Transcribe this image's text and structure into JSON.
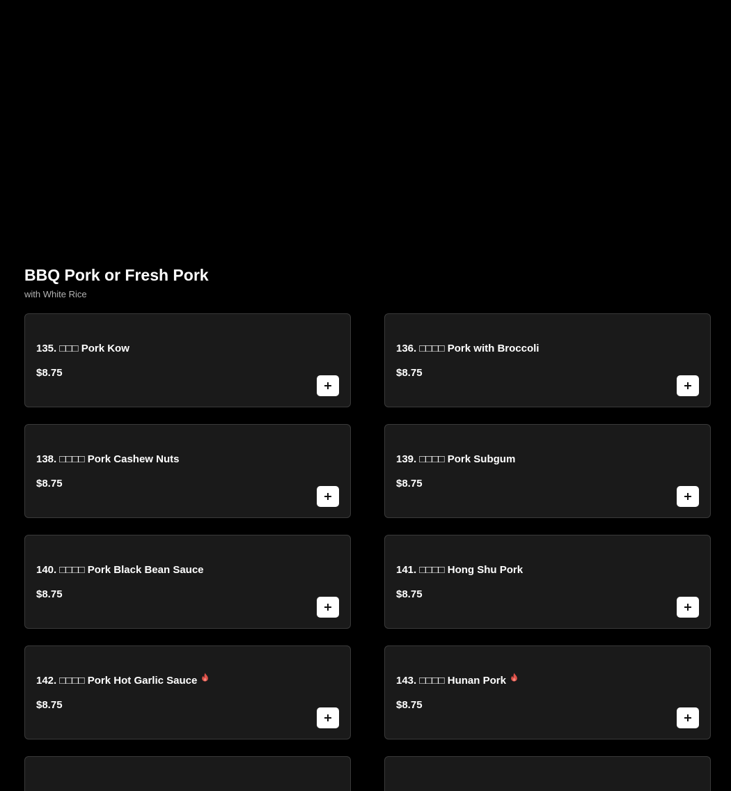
{
  "section": {
    "title": "BBQ Pork or Fresh Pork",
    "subtitle": "with White Rice"
  },
  "colors": {
    "background": "#000000",
    "card_background": "#1a1a1a",
    "card_border": "#3a3a3a",
    "spicy": "#e0524a"
  },
  "items": [
    {
      "name": "135. □□□ Pork Kow",
      "price": "$8.75",
      "spicy": false
    },
    {
      "name": "136. □□□□ Pork with Broccoli",
      "price": "$8.75",
      "spicy": false
    },
    {
      "name": "138. □□□□ Pork Cashew Nuts",
      "price": "$8.75",
      "spicy": false
    },
    {
      "name": "139. □□□□ Pork Subgum",
      "price": "$8.75",
      "spicy": false
    },
    {
      "name": "140. □□□□ Pork Black Bean Sauce",
      "price": "$8.75",
      "spicy": false
    },
    {
      "name": "141. □□□□ Hong Shu Pork",
      "price": "$8.75",
      "spicy": false
    },
    {
      "name": "142. □□□□ Pork Hot Garlic Sauce",
      "price": "$8.75",
      "spicy": true
    },
    {
      "name": "143. □□□□ Hunan Pork",
      "price": "$8.75",
      "spicy": true
    }
  ],
  "icons": {
    "add": "plus-icon",
    "spicy": "fire-icon"
  }
}
